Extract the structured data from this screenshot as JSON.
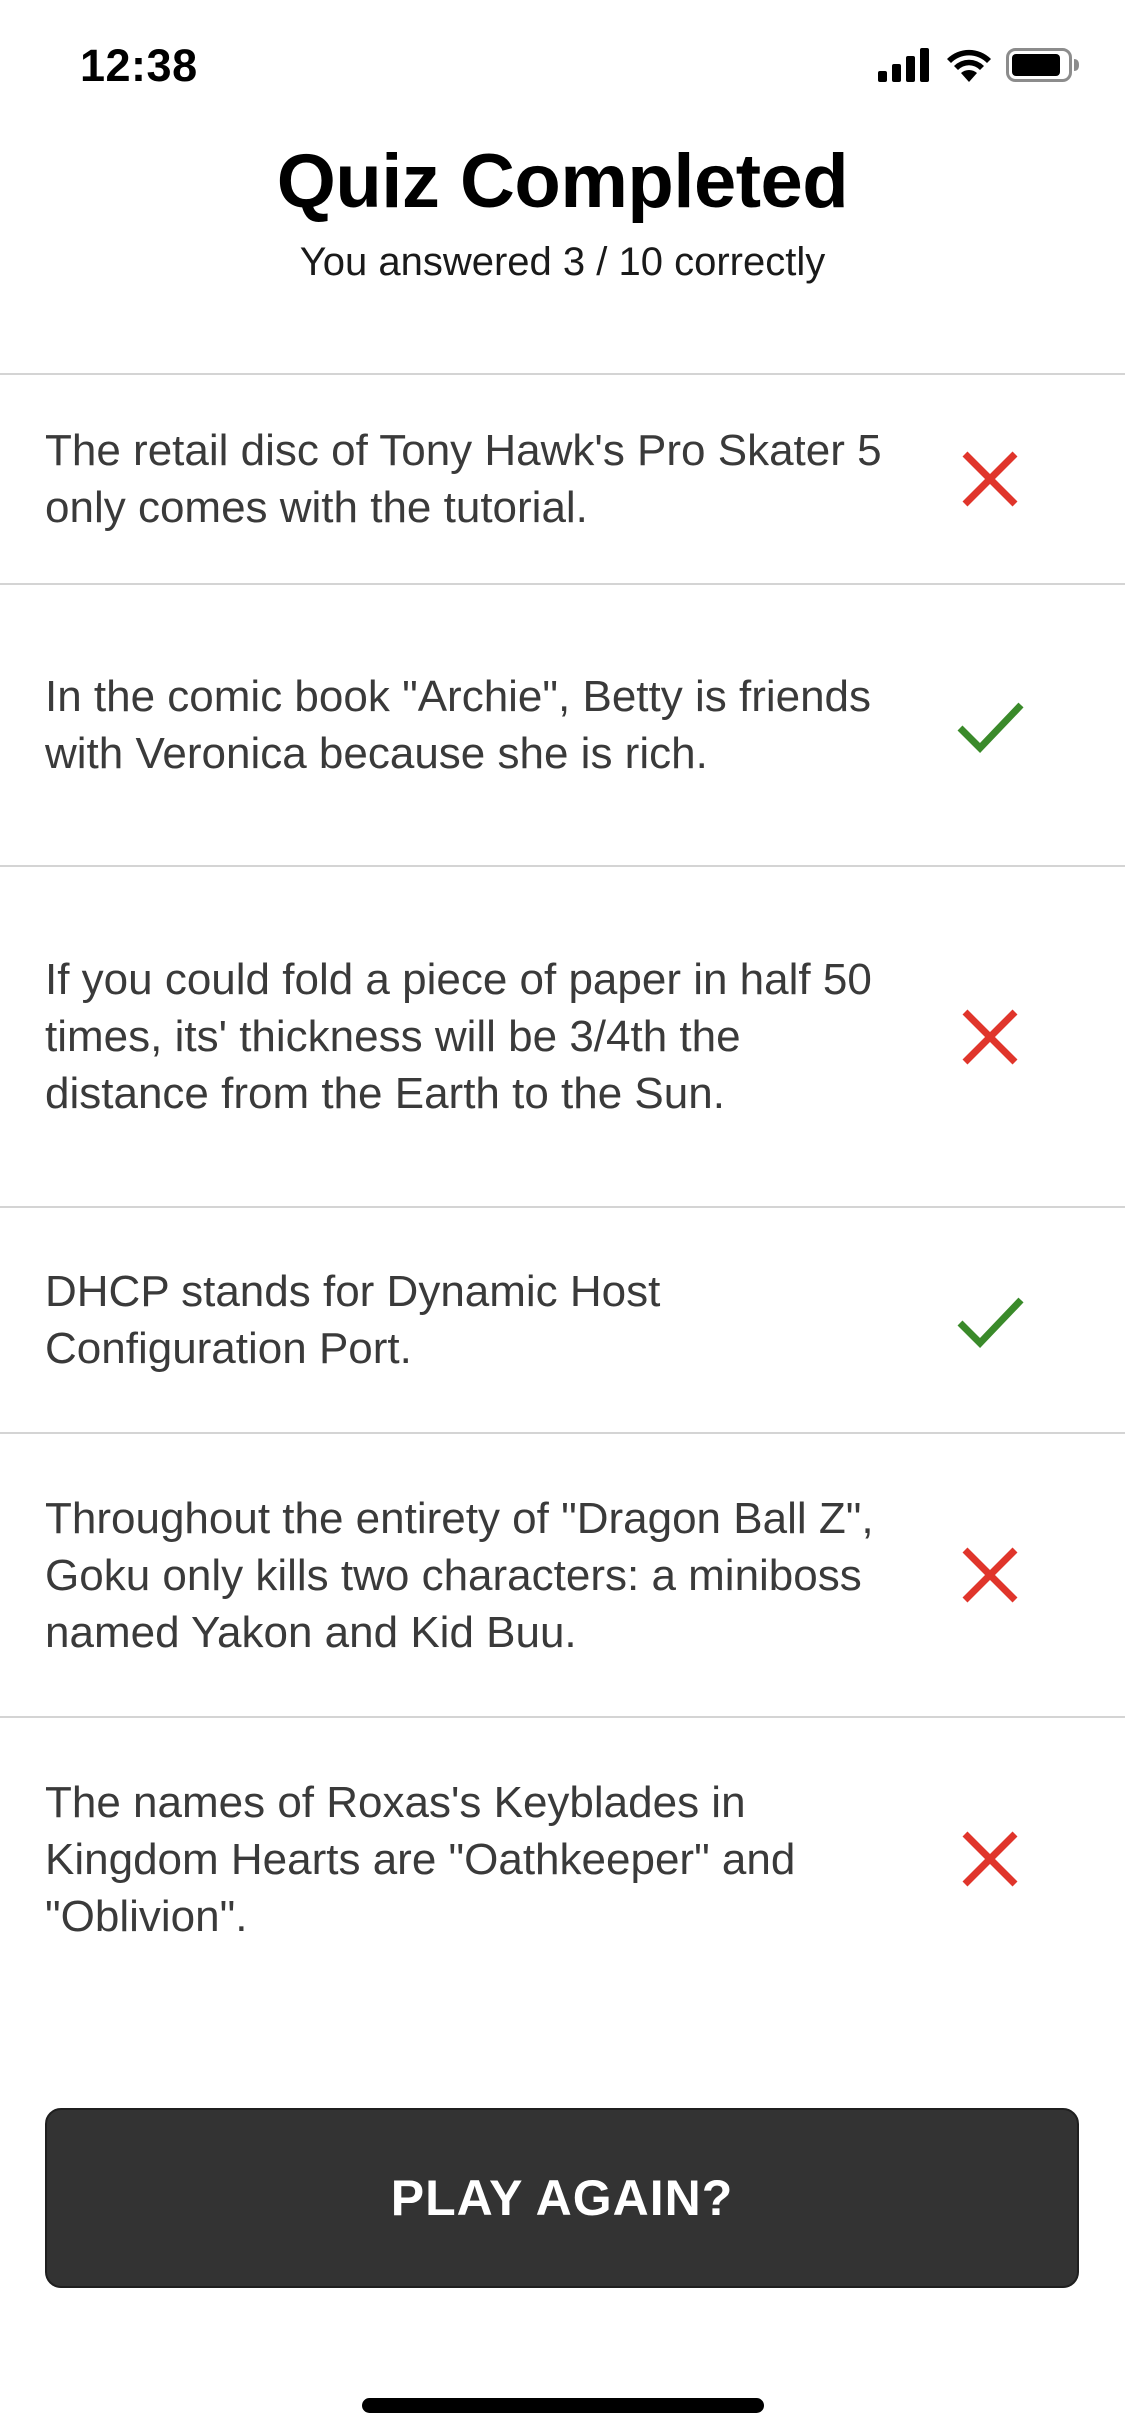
{
  "status_bar": {
    "time": "12:38",
    "icons": [
      "cellular-signal-icon",
      "wifi-icon",
      "battery-icon"
    ]
  },
  "header": {
    "title": "Quiz Completed",
    "subtitle": "You answered 3 / 10 correctly"
  },
  "results": [
    {
      "question": "The retail disc of Tony Hawk's Pro Skater 5 only comes with the tutorial.",
      "result": "incorrect",
      "icon": "cross-icon"
    },
    {
      "question": "In the comic book \"Archie\", Betty is friends with Veronica because she is rich.",
      "result": "correct",
      "icon": "checkmark-icon"
    },
    {
      "question": "If you could fold a piece of paper in half 50 times, its' thickness will be 3/4th the distance from the Earth to the Sun.",
      "result": "incorrect",
      "icon": "cross-icon"
    },
    {
      "question": "DHCP stands for Dynamic Host Configuration Port.",
      "result": "correct",
      "icon": "checkmark-icon"
    },
    {
      "question": "Throughout the entirety of \"Dragon Ball Z\", Goku only kills two characters: a miniboss named Yakon and Kid Buu.",
      "result": "incorrect",
      "icon": "cross-icon"
    },
    {
      "question": "The names of Roxas's Keyblades in Kingdom Hearts are \"Oathkeeper\" and \"Oblivion\".",
      "result": "incorrect",
      "icon": "cross-icon"
    }
  ],
  "colors": {
    "correct": "#3a8a2a",
    "incorrect": "#e0352b",
    "button_bg": "#333333",
    "button_text": "#ffffff"
  },
  "button": {
    "label": "PLAY AGAIN?"
  }
}
